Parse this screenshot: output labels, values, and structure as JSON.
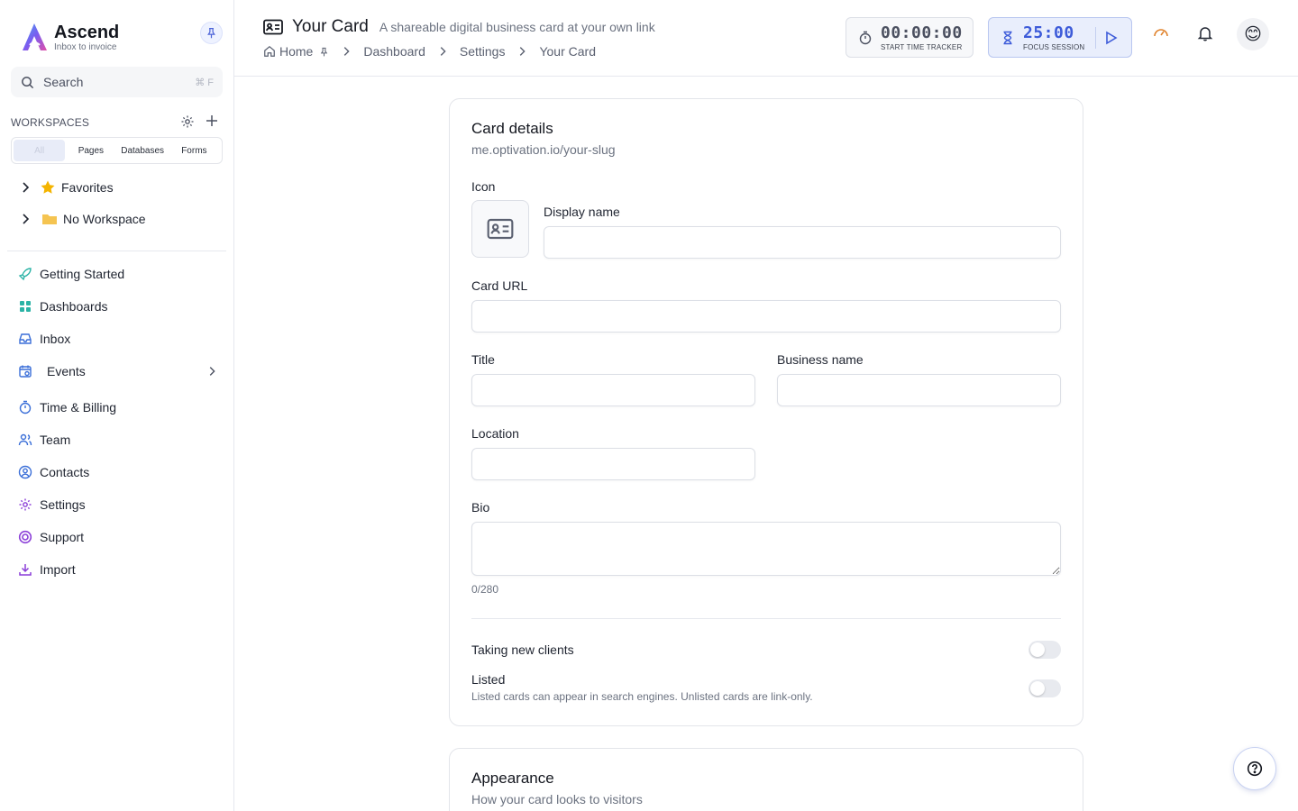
{
  "brand": {
    "name": "Ascend",
    "tagline": "Inbox to invoice"
  },
  "sidebar": {
    "search": {
      "label": "Search",
      "shortcut": "⌘ F"
    },
    "workspaces_label": "WORKSPACES",
    "filter_tabs": [
      "All",
      "Pages",
      "Databases",
      "Forms"
    ],
    "tree": [
      {
        "label": "Favorites",
        "icon": "star-icon"
      },
      {
        "label": "No Workspace",
        "icon": "folder-icon"
      }
    ],
    "nav": [
      {
        "label": "Getting Started",
        "icon": "rocket-icon",
        "color": "#2bb3a6"
      },
      {
        "label": "Dashboards",
        "icon": "grid-icon",
        "color": "#2bb3a6"
      },
      {
        "label": "Inbox",
        "icon": "inbox-icon",
        "color": "#3b6fd8"
      },
      {
        "label": "Events",
        "icon": "calendar-icon",
        "color": "#3b6fd8"
      },
      {
        "label": "Time & Billing",
        "icon": "timer-icon",
        "color": "#3b6fd8"
      },
      {
        "label": "Team",
        "icon": "users-icon",
        "color": "#3b6fd8"
      },
      {
        "label": "Contacts",
        "icon": "contact-icon",
        "color": "#3b6fd8"
      },
      {
        "label": "Settings",
        "icon": "gear-icon",
        "color": "#8b3fd8"
      },
      {
        "label": "Support",
        "icon": "lifebuoy-icon",
        "color": "#8b3fd8"
      },
      {
        "label": "Import",
        "icon": "download-icon",
        "color": "#8b3fd8"
      }
    ]
  },
  "header": {
    "title": "Your Card",
    "subtitle": "A shareable digital business card at your own link",
    "breadcrumb": [
      "Home",
      "Dashboard",
      "Settings",
      "Your Card"
    ],
    "tracker": {
      "time": "00:00:00",
      "caption": "START TIME TRACKER"
    },
    "focus": {
      "time": "25:00",
      "caption": "FOCUS SESSION"
    },
    "avatar": "😊"
  },
  "card": {
    "heading": "Card details",
    "url_hint": "me.optivation.io/your-slug",
    "icon_label": "Icon",
    "display_name_label": "Display name",
    "display_name_value": "",
    "card_url_label": "Card URL",
    "card_url_value": "",
    "title_label": "Title",
    "title_value": "",
    "business_label": "Business name",
    "business_value": "",
    "location_label": "Location",
    "location_value": "",
    "bio_label": "Bio",
    "bio_value": "",
    "bio_counter": "0/280",
    "taking_clients_label": "Taking new clients",
    "taking_clients_on": false,
    "listed_label": "Listed",
    "listed_on": false,
    "listed_note": "Listed cards can appear in search engines. Unlisted cards are link-only."
  },
  "appearance": {
    "heading": "Appearance",
    "subtitle": "How your card looks to visitors"
  },
  "colors": {
    "accent": "#3d5bd9",
    "focus_bg": "#e9eefc"
  }
}
